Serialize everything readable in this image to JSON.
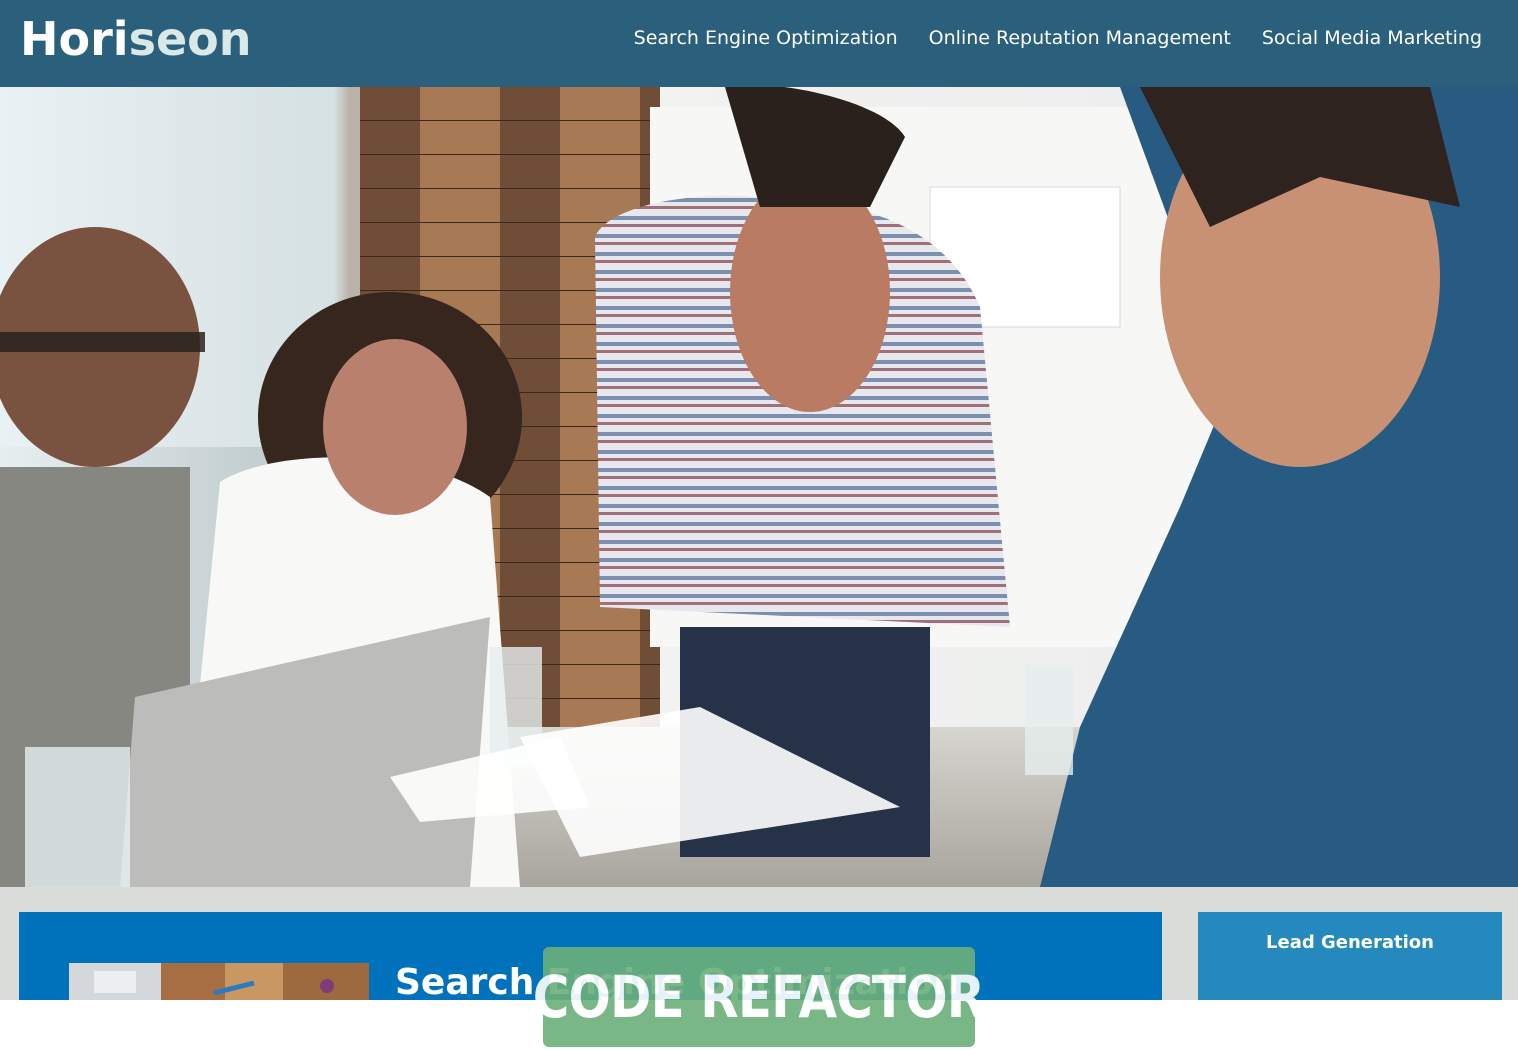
{
  "header": {
    "logo_main": "Hori",
    "logo_accent": "seon",
    "nav": [
      {
        "label": "Search Engine Optimization"
      },
      {
        "label": "Online Reputation Management"
      },
      {
        "label": "Social Media Marketing"
      }
    ]
  },
  "main_card": {
    "title": "Search Engine Optimization"
  },
  "side_card": {
    "title": "Lead Generation"
  },
  "badge": {
    "label": "CODE REFACTOR"
  },
  "colors": {
    "header_bg": "#2a607c",
    "main_card_bg": "#0072bb",
    "side_card_bg": "#2589bd",
    "badge_bg": "#6bb07b"
  }
}
